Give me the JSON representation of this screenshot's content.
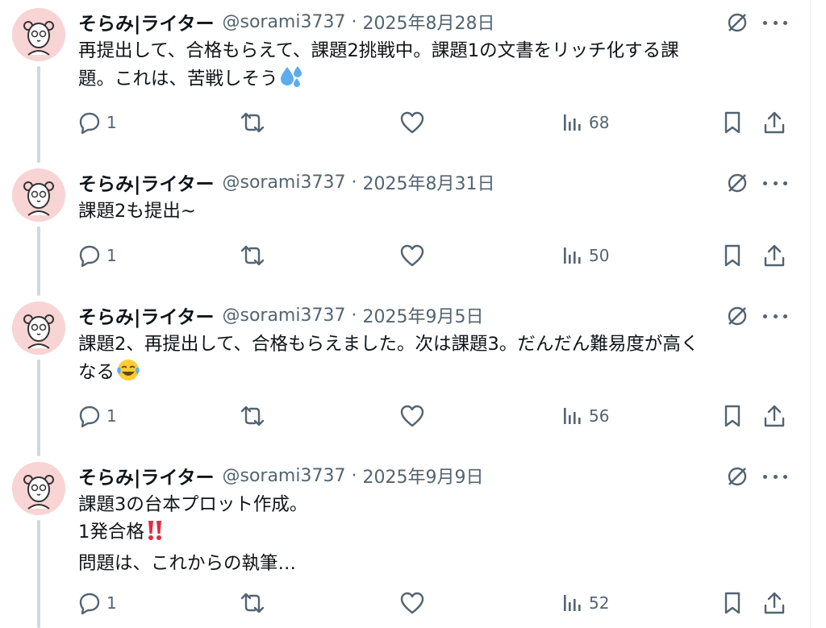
{
  "tweets": [
    {
      "name": "そらみ|ライター",
      "handle": "@sorami3737",
      "separator": "·",
      "date": "2025年8月28日",
      "lines": [
        "再提出して、合格もらえて、課題2挑戦中。課題1の文書をリッチ化する課",
        "題。これは、苦戦しそう"
      ],
      "emoji": "sweat-droplets",
      "replies": "1",
      "views": "68"
    },
    {
      "name": "そらみ|ライター",
      "handle": "@sorami3737",
      "separator": "·",
      "date": "2025年8月31日",
      "lines": [
        "課題2も提出~"
      ],
      "emoji": "",
      "replies": "1",
      "views": "50"
    },
    {
      "name": "そらみ|ライター",
      "handle": "@sorami3737",
      "separator": "·",
      "date": "2025年9月5日",
      "lines": [
        "課題2、再提出して、合格もらえました。次は課題3。だんだん難易度が高く",
        "なる"
      ],
      "emoji": "tears-of-joy",
      "replies": "1",
      "views": "56"
    },
    {
      "name": "そらみ|ライター",
      "handle": "@sorami3737",
      "separator": "·",
      "date": "2025年9月9日",
      "lines": [
        "課題3の台本プロット作成。",
        "1発合格",
        "問題は、これからの執筆…"
      ],
      "emoji": "double-exclamation",
      "replies": "1",
      "views": "52"
    }
  ],
  "colors": {
    "text": "#0f1419",
    "secondary": "#536471",
    "thread_line": "#cfd9de",
    "avatar_bg": "#f8d4d4"
  }
}
